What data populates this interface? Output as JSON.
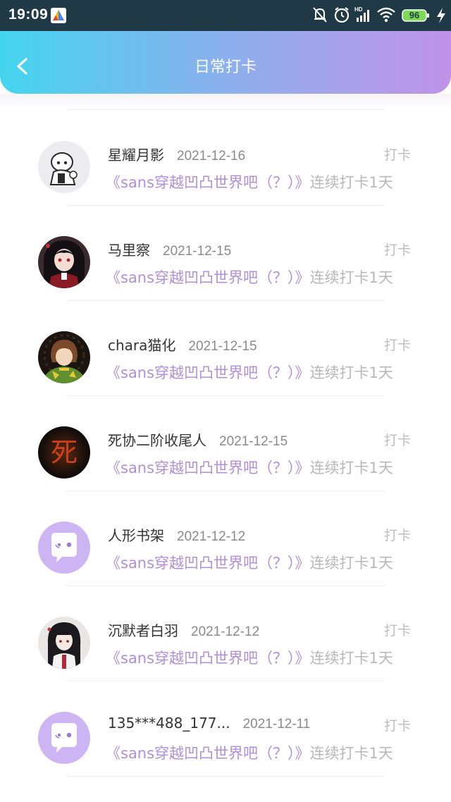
{
  "status_bar": {
    "time": "19:09",
    "battery": "96"
  },
  "header": {
    "title": "日常打卡"
  },
  "items": [
    {
      "name": "星耀月影",
      "date": "2021-12-16",
      "action": "打卡",
      "topic": "《sans穿越凹凸世界吧（？）》",
      "streak": "连续打卡1天",
      "avatar": "anime-avatar-grayscale"
    },
    {
      "name": "马里察",
      "date": "2021-12-15",
      "action": "打卡",
      "topic": "《sans穿越凹凸世界吧（？）》",
      "streak": "连续打卡1天",
      "avatar": "anime-avatar-red"
    },
    {
      "name": "chara猫化",
      "date": "2021-12-15",
      "action": "打卡",
      "topic": "《sans穿越凹凸世界吧（？）》",
      "streak": "连续打卡1天",
      "avatar": "anime-avatar-green"
    },
    {
      "name": "死协二阶收尾人",
      "date": "2021-12-15",
      "action": "打卡",
      "topic": "《sans穿越凹凸世界吧（？）》",
      "streak": "连续打卡1天",
      "avatar": "dark-glyph-avatar",
      "avatar_glyph": "死"
    },
    {
      "name": "人形书架",
      "date": "2021-12-12",
      "action": "打卡",
      "topic": "《sans穿越凹凸世界吧（？）》",
      "streak": "连续打卡1天",
      "avatar": "default-avatar"
    },
    {
      "name": "沉默者白羽",
      "date": "2021-12-12",
      "action": "打卡",
      "topic": "《sans穿越凹凸世界吧（？）》",
      "streak": "连续打卡1天",
      "avatar": "anime-avatar-mono"
    },
    {
      "name": "135***488_177...",
      "date": "2021-12-11",
      "action": "打卡",
      "topic": "《sans穿越凹凸世界吧（？）》",
      "streak": "连续打卡1天",
      "avatar": "default-avatar"
    }
  ],
  "colors": {
    "gradient_start": "#44d5ee",
    "gradient_end": "#c093e8",
    "topic": "#b08fd8",
    "muted": "#b8b8b8",
    "default_avatar": "#cdb4f2"
  }
}
